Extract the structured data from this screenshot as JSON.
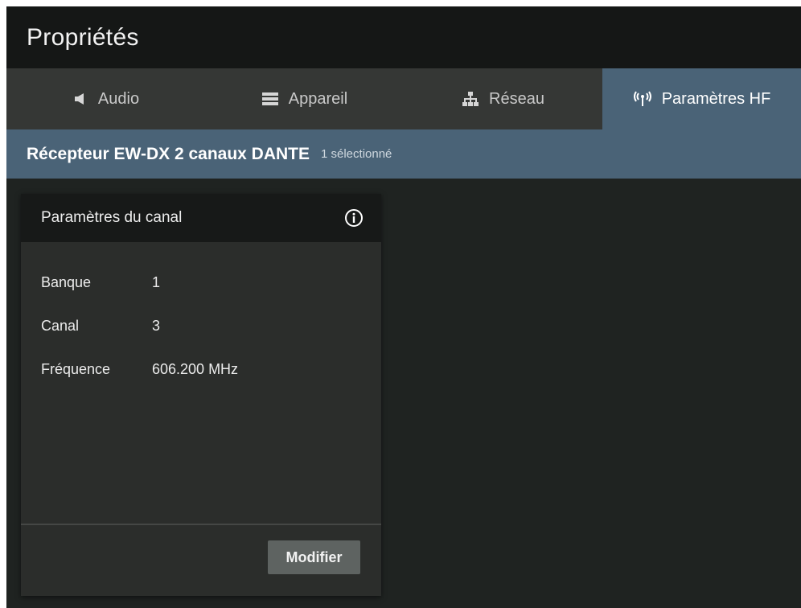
{
  "window": {
    "title": "Propriétés"
  },
  "tabs": [
    {
      "label": "Audio",
      "icon": "speaker-icon"
    },
    {
      "label": "Appareil",
      "icon": "device-icon"
    },
    {
      "label": "Réseau",
      "icon": "network-icon"
    },
    {
      "label": "Paramètres HF",
      "icon": "antenna-icon",
      "active": true
    }
  ],
  "subheader": {
    "device_name": "Récepteur EW-DX 2 canaux DANTE",
    "selection": "1 sélectionné"
  },
  "card": {
    "title": "Paramètres du canal",
    "info_icon": "info-icon",
    "properties": [
      {
        "label": "Banque",
        "value": "1"
      },
      {
        "label": "Canal",
        "value": "3"
      },
      {
        "label": "Fréquence",
        "value": "606.200 MHz"
      }
    ],
    "button_label": "Modifier"
  },
  "colors": {
    "background": "#1f2321",
    "titlebar": "#151716",
    "tab_bar": "#353735",
    "accent": "#4a6377",
    "card": "#2b2d2b",
    "button": "#5e6361"
  }
}
